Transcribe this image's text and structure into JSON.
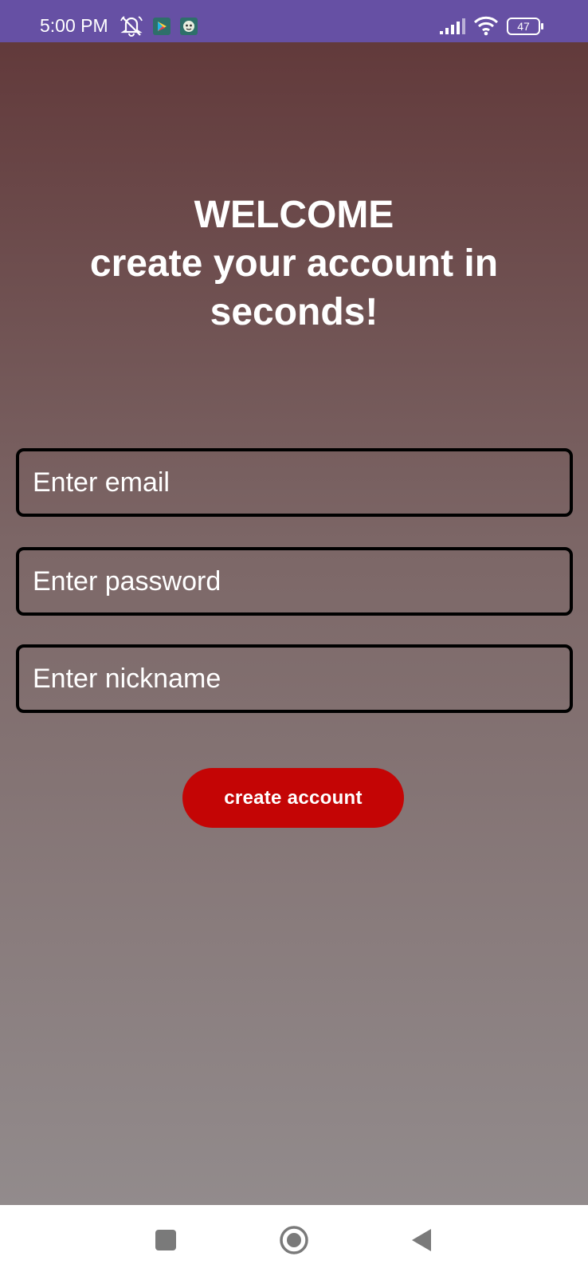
{
  "status_bar": {
    "time": "5:00 PM",
    "icons": [
      "alarm-off-icon",
      "app-notification-icon",
      "app-notification-icon-2",
      "signal-icon",
      "wifi-icon",
      "battery-icon"
    ],
    "battery_level": "47",
    "color": "#6650a4"
  },
  "welcome": {
    "line1": "WELCOME",
    "line2": "create your account in",
    "line3": "seconds!"
  },
  "form": {
    "email_placeholder": "Enter email",
    "password_placeholder": "Enter password",
    "nickname_placeholder": "Enter nickname",
    "create_button_label": "create account",
    "button_color": "#c40505"
  },
  "nav_bar": {
    "icons": [
      "recents-square-icon",
      "home-circle-icon",
      "back-triangle-icon"
    ]
  }
}
